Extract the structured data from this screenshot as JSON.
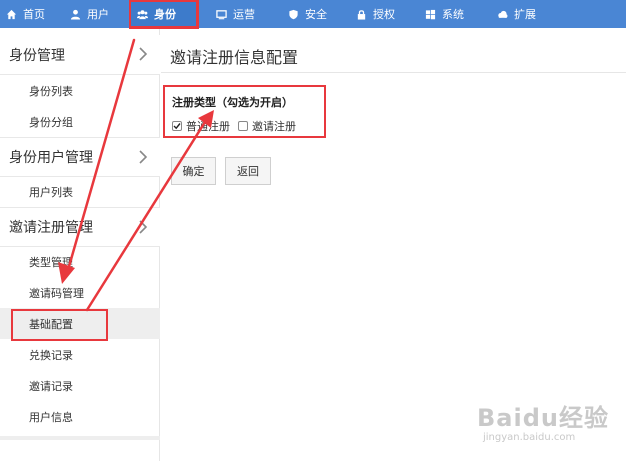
{
  "topnav": {
    "items": [
      {
        "label": "首页",
        "icon": "home-icon"
      },
      {
        "label": "用户",
        "icon": "user-icon"
      },
      {
        "label": "身份",
        "icon": "users-icon",
        "active": true
      },
      {
        "label": "运营",
        "icon": "monitor-icon"
      },
      {
        "label": "安全",
        "icon": "shield-icon"
      },
      {
        "label": "授权",
        "icon": "lock-icon"
      },
      {
        "label": "系统",
        "icon": "windows-icon"
      },
      {
        "label": "扩展",
        "icon": "cloud-icon"
      }
    ],
    "bg_color": "#4a86d4"
  },
  "sidebar": {
    "groups": [
      {
        "label": "身份管理",
        "items": [
          "身份列表",
          "身份分组"
        ]
      },
      {
        "label": "身份用户管理",
        "items": [
          "用户列表"
        ]
      },
      {
        "label": "邀请注册管理",
        "items": [
          "类型管理",
          "邀请码管理",
          "基础配置",
          "兑换记录",
          "邀请记录",
          "用户信息"
        ]
      }
    ],
    "selected_item": "基础配置"
  },
  "main": {
    "title": "邀请注册信息配置",
    "field_label": "注册类型（勾选为开启）",
    "options": [
      {
        "label": "普通注册",
        "checked": true
      },
      {
        "label": "邀请注册",
        "checked": false
      }
    ],
    "buttons": {
      "confirm": "确定",
      "back": "返回"
    }
  },
  "annotation_color": "#e8383d",
  "watermark": {
    "logo": "Baidu经验",
    "url": "jingyan.baidu.com"
  }
}
